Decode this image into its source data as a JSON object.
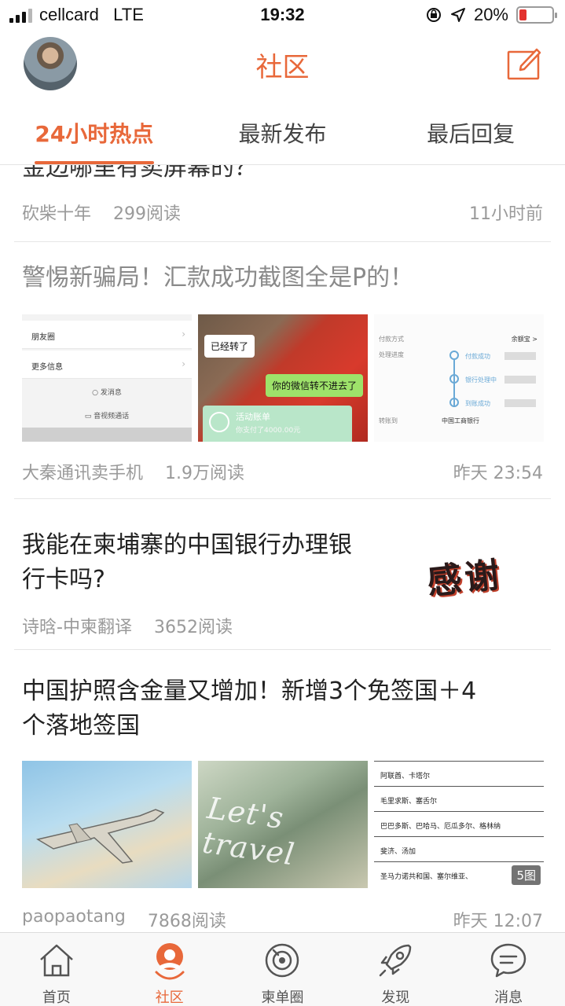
{
  "status_bar": {
    "carrier": "cellcard",
    "network": "LTE",
    "time": "19:32",
    "battery": "20%",
    "battery_level": 0.2
  },
  "header": {
    "title": "社区"
  },
  "tabs": [
    {
      "label": "24小时热点",
      "active": true
    },
    {
      "label": "最新发布",
      "active": false
    },
    {
      "label": "最后回复",
      "active": false
    }
  ],
  "posts": [
    {
      "title": "金边哪里有卖屏幕的？",
      "author": "砍柴十年",
      "reads": "299阅读",
      "time": "11小时前"
    },
    {
      "title": "警惕新骗局！汇款成功截图全是P的！",
      "author": "大秦通讯卖手机",
      "reads": "1.9万阅读",
      "time": "昨天 23:54",
      "images": {
        "settings": {
          "row1": "朋友圈",
          "row2": "更多信息",
          "send_msg": "发消息",
          "video_call": "音视频通话"
        },
        "chat": {
          "bubble1": "已经转了",
          "bubble2": "你的微信转不进去了",
          "card_title": "活动账单",
          "card_sub": "你支付了4000.00元"
        },
        "bank": {
          "pay_method": "付款方式",
          "pay_value": "余额宝 >",
          "progress": "处理进度",
          "step1": "付款成功",
          "step2": "银行处理中",
          "step3": "到账成功",
          "to_account": "转账到",
          "bank_name": "中国工商银行"
        }
      }
    },
    {
      "title_line1": "我能在柬埔寨的中国银行办理银",
      "title_line2": "行卡吗?",
      "author": "诗晗-中柬翻译",
      "reads": "3652阅读",
      "thumb_text": "感谢"
    },
    {
      "title_line1": "中国护照含金量又增加！新增3个免签国＋4",
      "title_line2": "个落地签国",
      "author": "paopaotang",
      "reads": "7868阅读",
      "time": "昨天 12:07",
      "image_count": "5图",
      "travel_text": "Let's travel",
      "country_rows": [
        "阿联酋、卡塔尔",
        "毛里求斯、塞舌尔",
        "巴巴多斯、巴哈马、厄瓜多尔、格林纳",
        "斐济、汤加",
        "圣马力诺共和国、塞尔维亚、"
      ]
    }
  ],
  "bottom_nav": [
    {
      "label": "首页",
      "icon": "home-icon",
      "active": false
    },
    {
      "label": "社区",
      "icon": "community-icon",
      "active": true
    },
    {
      "label": "柬单圈",
      "icon": "circle-icon",
      "active": false
    },
    {
      "label": "发现",
      "icon": "rocket-icon",
      "active": false
    },
    {
      "label": "消息",
      "icon": "message-icon",
      "active": false
    }
  ],
  "colors": {
    "accent": "#e8683a",
    "text": "#222222",
    "meta": "#9a9a9a"
  }
}
